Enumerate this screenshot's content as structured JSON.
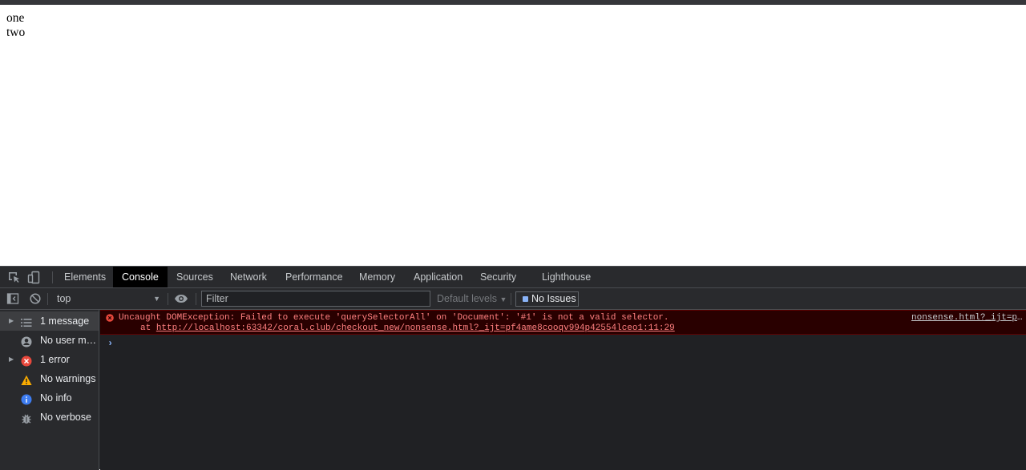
{
  "page": {
    "lines": [
      "one",
      "two"
    ]
  },
  "devtools": {
    "tabs": [
      {
        "label": "Elements"
      },
      {
        "label": "Console"
      },
      {
        "label": "Sources"
      },
      {
        "label": "Network"
      },
      {
        "label": "Performance"
      },
      {
        "label": "Memory"
      },
      {
        "label": "Application"
      },
      {
        "label": "Security"
      },
      {
        "label": "Lighthouse"
      }
    ],
    "active_tab": "Console",
    "toolbar": {
      "context": "top",
      "filter_placeholder": "Filter",
      "levels": "Default levels",
      "issues": "No Issues"
    },
    "sidebar": [
      {
        "label": "1 message",
        "icon": "list-icon"
      },
      {
        "label": "No user me…",
        "icon": "user-icon"
      },
      {
        "label": "1 error",
        "icon": "error-icon"
      },
      {
        "label": "No warnings",
        "icon": "warning-icon"
      },
      {
        "label": "No info",
        "icon": "info-icon"
      },
      {
        "label": "No verbose",
        "icon": "bug-icon"
      }
    ],
    "error": {
      "message": "Uncaught DOMException: Failed to execute 'querySelectorAll' on 'Document': '#1' is not a valid selector.",
      "at_prefix": "at",
      "url": "http://localhost:63342/coral.club/checkout_new/nonsense.html?_ijt=pf4ame8cooqv994p42554lceo1:11:29",
      "source": "nonsense.html?_ijt=p…c"
    }
  },
  "colors": {
    "panel": "#292a2d",
    "background": "#202124",
    "error_bg": "#290000",
    "error_text": "#ff8080",
    "accent": "#8ab4f8"
  }
}
